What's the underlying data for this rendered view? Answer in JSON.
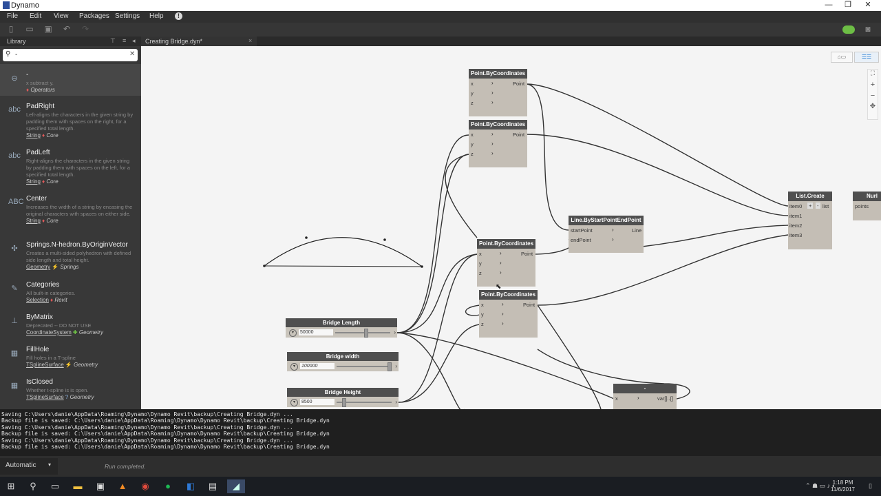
{
  "window": {
    "title": "Dynamo",
    "controls": [
      "—",
      "❐",
      "❐",
      "✕"
    ]
  },
  "menu": [
    "File",
    "Edit",
    "View",
    "Packages",
    "Settings",
    "Help"
  ],
  "library": {
    "title": "Library",
    "search_value": "-",
    "items": [
      {
        "name": "-",
        "desc": "x subtract y.",
        "category": "",
        "sub": "Operators",
        "icon": "minus-icon"
      },
      {
        "name": "PadRight",
        "desc": "Left-aligns the characters in the given string by padding them with spaces on the right, for a specified total length.",
        "category": "String",
        "sub": "Core",
        "icon": "padright-icon"
      },
      {
        "name": "PadLeft",
        "desc": "Right-aligns the characters in the given string by padding them with spaces on the left, for a specified total length.",
        "category": "String",
        "sub": "Core",
        "icon": "padleft-icon"
      },
      {
        "name": "Center",
        "desc": "Increases the width of a string by encasing the original characters with spaces on either side.",
        "category": "String",
        "sub": "Core",
        "icon": "center-icon"
      },
      {
        "name": "Springs.N-hedron.ByOriginVector",
        "desc": "Creates a multi-sided polyhedron with defined side length and total height.",
        "category": "Geometry",
        "sub": "Springs",
        "icon": "puzzle-icon"
      },
      {
        "name": "Categories",
        "desc": "All built-in categories.",
        "category": "Selection",
        "sub": "Revit",
        "icon": "categories-icon"
      },
      {
        "name": "ByMatrix",
        "desc": "Deprecated -- DO NOT USE",
        "category": "CoordinateSystem",
        "sub": "Geometry",
        "icon": "coordsys-icon"
      },
      {
        "name": "FillHole",
        "desc": "Fill holes in a T-spline",
        "category": "TSplineSurface",
        "sub": "Geometry",
        "icon": "tspline-icon"
      },
      {
        "name": "IsClosed",
        "desc": "Whether t-spline is is open.",
        "category": "TSplineSurface",
        "sub": "Geometry",
        "icon": "tspline-icon"
      }
    ]
  },
  "tab": {
    "label": "Creating Bridge.dyn*",
    "close": "×"
  },
  "nodes": {
    "pbc1": {
      "title": "Point.ByCoordinates",
      "in": [
        "x",
        "y",
        "z"
      ],
      "out": "Point"
    },
    "pbc2": {
      "title": "Point.ByCoordinates",
      "in": [
        "x",
        "y",
        "z"
      ],
      "out": "Point"
    },
    "pbc3": {
      "title": "Point.ByCoordinates",
      "in": [
        "x",
        "y",
        "z"
      ],
      "out": "Point"
    },
    "pbc4": {
      "title": "Point.ByCoordinates",
      "in": [
        "x",
        "y",
        "z"
      ],
      "out": "Point"
    },
    "line": {
      "title": "Line.ByStartPointEndPoint",
      "in": [
        "startPoint",
        "endPoint"
      ],
      "out": "Line"
    },
    "listcreate": {
      "title": "List.Create",
      "in": [
        "item0",
        "item1",
        "item2",
        "item3"
      ],
      "out": "list",
      "plus": "+",
      "minus": "-"
    },
    "nurbs": {
      "title": "Nurl",
      "in": [
        "points"
      ]
    },
    "minus": {
      "title": "-",
      "in": [
        "x"
      ],
      "out": "var[]..[]"
    }
  },
  "sliders": {
    "length": {
      "title": "Bridge Length",
      "value": "50000",
      "fraction": 0.55
    },
    "width": {
      "title": "Bridge width",
      "value": "100000",
      "fraction": 0.98
    },
    "height": {
      "title": "Bridge Height",
      "value": "8500",
      "fraction": 0.1
    }
  },
  "console": [
    "Saving C:\\Users\\danie\\AppData\\Roaming\\Dynamo\\Dynamo Revit\\backup\\Creating Bridge.dyn ...",
    "Backup file is saved: C:\\Users\\danie\\AppData\\Roaming\\Dynamo\\Dynamo Revit\\backup\\Creating Bridge.dyn",
    "Saving C:\\Users\\danie\\AppData\\Roaming\\Dynamo\\Dynamo Revit\\backup\\Creating Bridge.dyn ...",
    "Backup file is saved: C:\\Users\\danie\\AppData\\Roaming\\Dynamo\\Dynamo Revit\\backup\\Creating Bridge.dyn",
    "Saving C:\\Users\\danie\\AppData\\Roaming\\Dynamo\\Dynamo Revit\\backup\\Creating Bridge.dyn ...",
    "Backup file is saved: C:\\Users\\danie\\AppData\\Roaming\\Dynamo\\Dynamo Revit\\backup\\Creating Bridge.dyn"
  ],
  "runbar": {
    "mode": "Automatic",
    "status": "Run completed."
  },
  "taskbar": {
    "time": "1:18 PM",
    "date": "11/6/2017"
  },
  "colors": {
    "menu_bg": "#303030",
    "library_bg": "#383838",
    "node_header": "#4f4f4f",
    "node_body": "#c4beb5",
    "canvas": "#f4f4f4",
    "accent_green": "#6dbe45"
  }
}
